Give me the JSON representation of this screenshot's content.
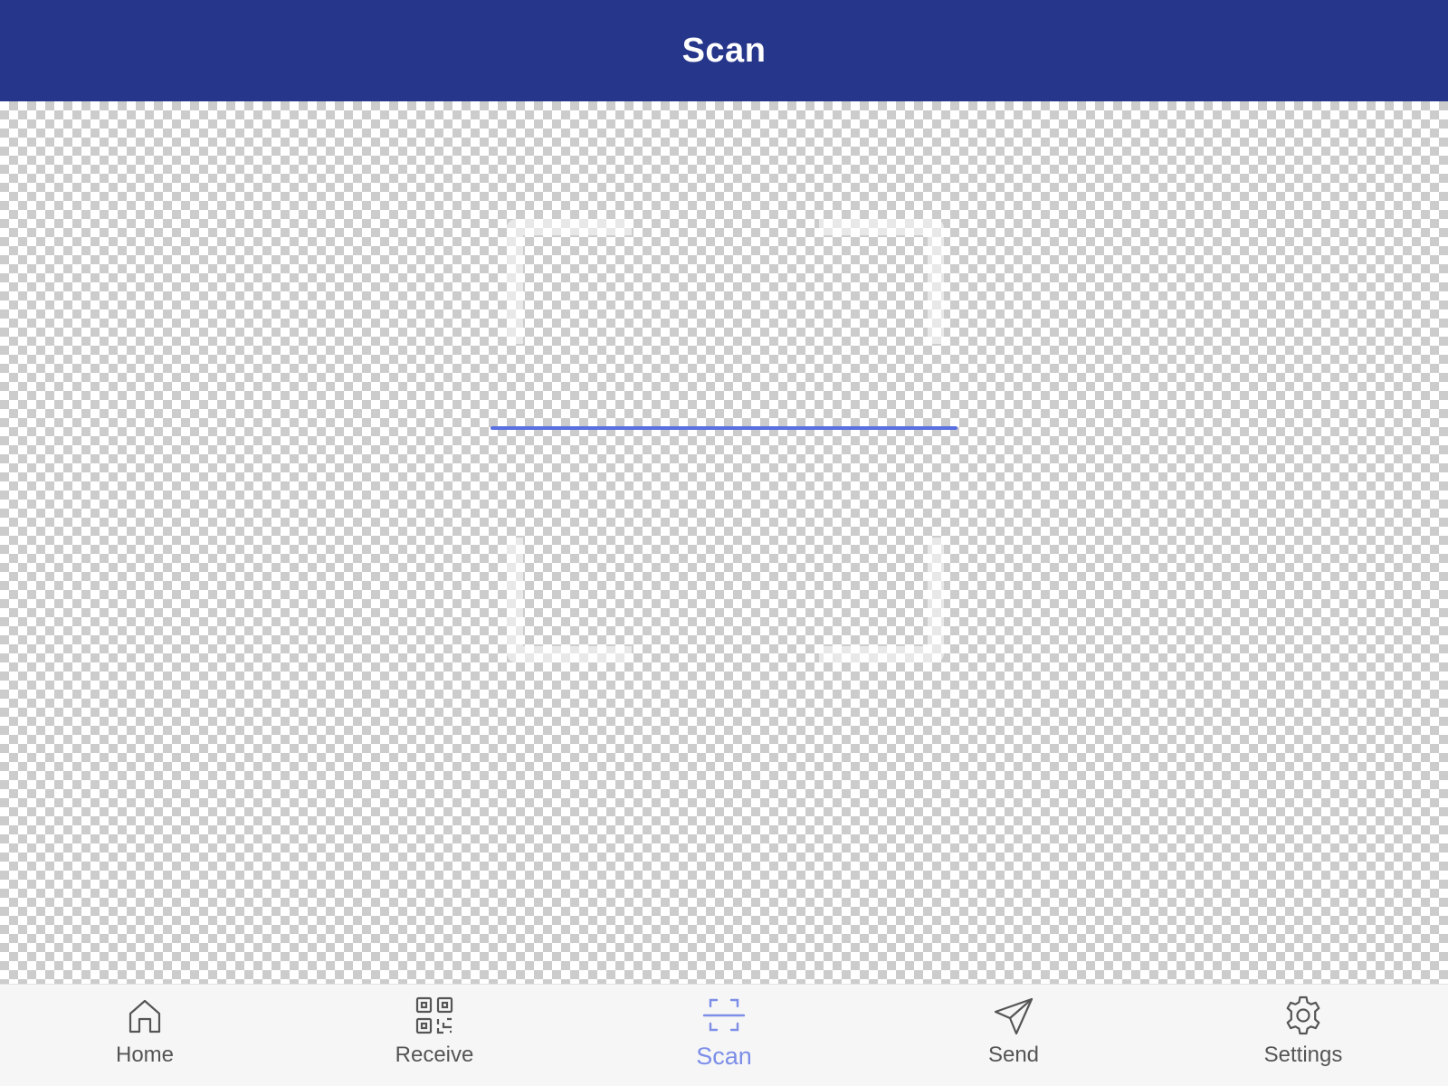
{
  "header": {
    "title": "Scan"
  },
  "scanner": {
    "scan_line_color": "#5a6fe0"
  },
  "tabs": [
    {
      "label": "Home",
      "icon": "home-icon",
      "active": false
    },
    {
      "label": "Receive",
      "icon": "qr-code-icon",
      "active": false
    },
    {
      "label": "Scan",
      "icon": "scan-icon",
      "active": true
    },
    {
      "label": "Send",
      "icon": "paper-plane-icon",
      "active": false
    },
    {
      "label": "Settings",
      "icon": "gear-icon",
      "active": false
    }
  ],
  "colors": {
    "header_background": "#26368a",
    "active_tab": "#7c8ee8",
    "inactive_tab": "#555555"
  }
}
